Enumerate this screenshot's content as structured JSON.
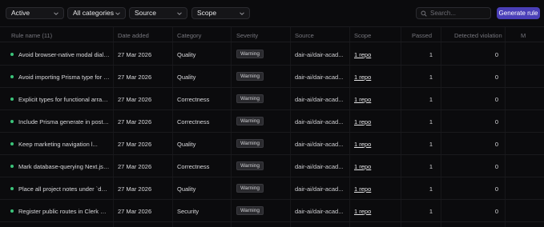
{
  "filters": {
    "status": "Active",
    "categories": "All categories",
    "source": "Source",
    "scope": "Scope"
  },
  "search": {
    "placeholder": "Search..."
  },
  "actions": {
    "generate_label": "Generate rule"
  },
  "table": {
    "headers": {
      "rule_name": "Rule name (11)",
      "date_added": "Date added",
      "category": "Category",
      "severity": "Severity",
      "source": "Source",
      "scope": "Scope",
      "passed": "Passed",
      "violation": "Detected violation",
      "extra": "M"
    },
    "rows": [
      {
        "name": "Avoid browser-native modal dialo...",
        "date": "27 Mar 2026",
        "category": "Quality",
        "severity": "Warning",
        "source": "dair-ai/dair-acad...",
        "scope": "1 repo",
        "passed": "1",
        "violation": "0"
      },
      {
        "name": "Avoid importing Prisma type for w...",
        "date": "27 Mar 2026",
        "category": "Quality",
        "severity": "Warning",
        "source": "dair-ai/dair-acad...",
        "scope": "1 repo",
        "passed": "1",
        "violation": "0"
      },
      {
        "name": "Explicit types for functional array ...",
        "date": "27 Mar 2026",
        "category": "Correctness",
        "severity": "Warning",
        "source": "dair-ai/dair-acad...",
        "scope": "1 repo",
        "passed": "1",
        "violation": "0"
      },
      {
        "name": "Include Prisma generate in postin...",
        "date": "27 Mar 2026",
        "category": "Correctness",
        "severity": "Warning",
        "source": "dair-ai/dair-acad...",
        "scope": "1 repo",
        "passed": "1",
        "violation": "0"
      },
      {
        "name": "Keep marketing navigation l...",
        "date": "27 Mar 2026",
        "category": "Quality",
        "severity": "Warning",
        "source": "dair-ai/dair-acad...",
        "scope": "1 repo",
        "passed": "1",
        "violation": "0"
      },
      {
        "name": "Mark database-querying Next.js ...",
        "date": "27 Mar 2026",
        "category": "Correctness",
        "severity": "Warning",
        "source": "dair-ai/dair-acad...",
        "scope": "1 repo",
        "passed": "1",
        "violation": "0"
      },
      {
        "name": "Place all project notes under `dair...",
        "date": "27 Mar 2026",
        "category": "Quality",
        "severity": "Warning",
        "source": "dair-ai/dair-acad...",
        "scope": "1 repo",
        "passed": "1",
        "violation": "0"
      },
      {
        "name": "Register public routes in Clerk mi...",
        "date": "27 Mar 2026",
        "category": "Security",
        "severity": "Warning",
        "source": "dair-ai/dair-acad...",
        "scope": "1 repo",
        "passed": "1",
        "violation": "0"
      }
    ]
  }
}
